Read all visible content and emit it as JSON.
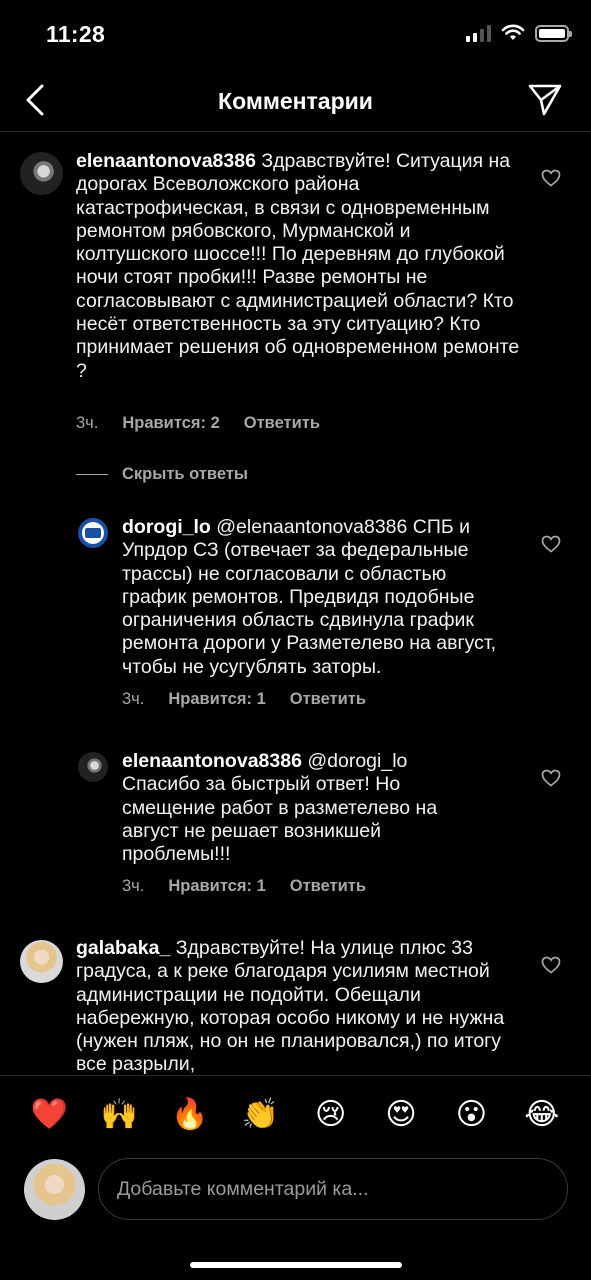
{
  "status": {
    "time": "11:28"
  },
  "header": {
    "title": "Комментарии"
  },
  "comments": [
    {
      "user": "elenaantonova8386",
      "text": "Здравствуйте! Ситуация на дорогах Всеволожского района катастрофическая, в связи с одновременным ремонтом рябовского, Мурманской и колтушского шоссе!!! По деревням до  глубокой ночи стоят пробки!!! Разве ремонты не согласовывают с администрацией области? Кто несёт ответственность за эту ситуацию? Кто принимает решения об одновременном ремонте ?",
      "time": "3ч.",
      "likes": "Нравится: 2",
      "reply": "Ответить"
    }
  ],
  "hide_replies": "Скрыть ответы",
  "replies": [
    {
      "user": "dorogi_lo",
      "text": "@elenaantonova8386 СПБ  и Упрдор СЗ (отвечает за федеральные трассы) не согласовали с областью график ремонтов. Предвидя подобные ограничения область сдвинула график ремонта дороги у Разметелево на август, чтобы не усугублять заторы.",
      "time": "3ч.",
      "likes": "Нравится: 1",
      "reply": "Ответить"
    },
    {
      "user": "elenaantonova8386",
      "text": "@dorogi_lo Спасибо за быстрый ответ! Но смещение работ в разметелево на август не решает возникшей проблемы!!!",
      "time": "3ч.",
      "likes": "Нравится: 1",
      "reply": "Ответить"
    }
  ],
  "comment2": {
    "user": "galabaka_",
    "text": "Здравствуйте! На улице плюс 33 градуса, а к реке благодаря усилиям местной администрации не подойти. Обещали набережную, которая особо никому и не нужна (нужен пляж, но он не планировался,) по итогу все разрыли,"
  },
  "emoji_bar": [
    "❤️",
    "🙌",
    "🔥",
    "👏",
    "😢",
    "😍",
    "😮",
    "😂"
  ],
  "input": {
    "placeholder": "Добавьте комментарий ка..."
  },
  "colors": {
    "background": "#000000",
    "secondary_text": "#a8a8a8",
    "divider": "#262626"
  }
}
